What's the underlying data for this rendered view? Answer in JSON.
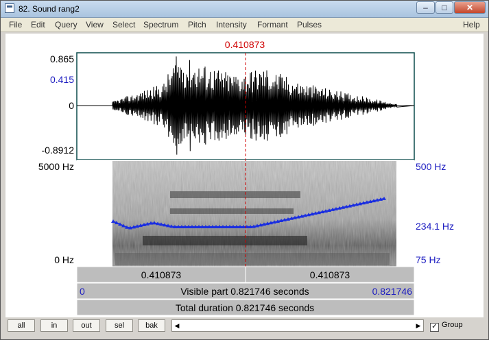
{
  "window": {
    "title": "82. Sound rang2",
    "controls": {
      "minimize": "–",
      "maximize": "□",
      "close": "✕"
    }
  },
  "menu": {
    "items": [
      "File",
      "Edit",
      "Query",
      "View",
      "Select",
      "Spectrum",
      "Pitch",
      "Intensity",
      "Formant",
      "Pulses"
    ],
    "help": "Help"
  },
  "cursor": {
    "time_label": "0.410873"
  },
  "waveform": {
    "y_max": "0.865",
    "y_mark": "0.415",
    "y_zero": "0",
    "y_min": "-0.8912"
  },
  "spectrogram": {
    "freq_top": "5000 Hz",
    "freq_bottom": "0 Hz"
  },
  "pitch": {
    "top": "500 Hz",
    "current": "234.1 Hz",
    "bottom": "75 Hz"
  },
  "time_bar": {
    "left_segment": "0.410873",
    "right_segment": "0.410873",
    "visible_start": "0",
    "visible_label": "Visible part 0.821746 seconds",
    "visible_end": "0.821746",
    "total_label": "Total duration 0.821746 seconds"
  },
  "buttons": {
    "all": "all",
    "in": "in",
    "out": "out",
    "sel": "sel",
    "bak": "bak"
  },
  "scrollbar": {
    "left_arrow": "◀",
    "right_arrow": "▶"
  },
  "group": {
    "label": "Group",
    "checked": "✓"
  },
  "colors": {
    "cursor": "#d00000",
    "pitch": "#1a2ee0",
    "axis_blue": "#1a1ac0",
    "frame": "#0a4a4a"
  }
}
